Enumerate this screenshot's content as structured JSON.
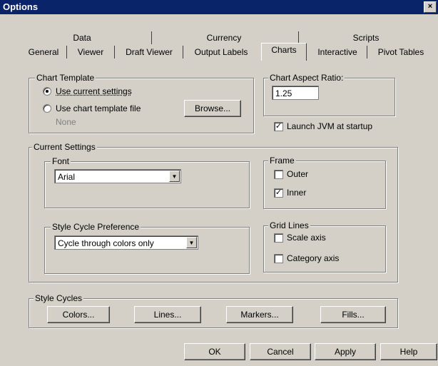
{
  "window": {
    "title": "Options",
    "close_glyph": "×"
  },
  "tabs_row1": [
    "Data",
    "Currency",
    "Scripts"
  ],
  "tabs_row2": [
    "General",
    "Viewer",
    "Draft Viewer",
    "Output Labels",
    "Charts",
    "Interactive",
    "Pivot Tables"
  ],
  "active_tab": "Charts",
  "chart_template": {
    "label": "Chart Template",
    "opt_current": "Use current settings",
    "opt_file": "Use chart template file",
    "file_value": "None",
    "browse": "Browse..."
  },
  "aspect_ratio": {
    "label": "Chart Aspect Ratio:",
    "value": "1.25"
  },
  "launch_jvm": {
    "label": "Launch JVM at startup",
    "checked": true
  },
  "current_settings": {
    "label": "Current Settings",
    "font_label": "Font",
    "font_value": "Arial",
    "style_cycle_label": "Style Cycle Preference",
    "style_cycle_value": "Cycle through colors only"
  },
  "frame": {
    "label": "Frame",
    "outer": "Outer",
    "inner": "Inner",
    "outer_checked": false,
    "inner_checked": true
  },
  "grid_lines": {
    "label": "Grid Lines",
    "scale_axis": "Scale axis",
    "category_axis": "Category axis"
  },
  "style_cycles": {
    "label": "Style Cycles",
    "colors": "Colors...",
    "lines": "Lines...",
    "markers": "Markers...",
    "fills": "Fills..."
  },
  "footer": {
    "ok": "OK",
    "cancel": "Cancel",
    "apply": "Apply",
    "help": "Help"
  },
  "icons": {
    "check": "✓",
    "dropdown": "▼"
  }
}
